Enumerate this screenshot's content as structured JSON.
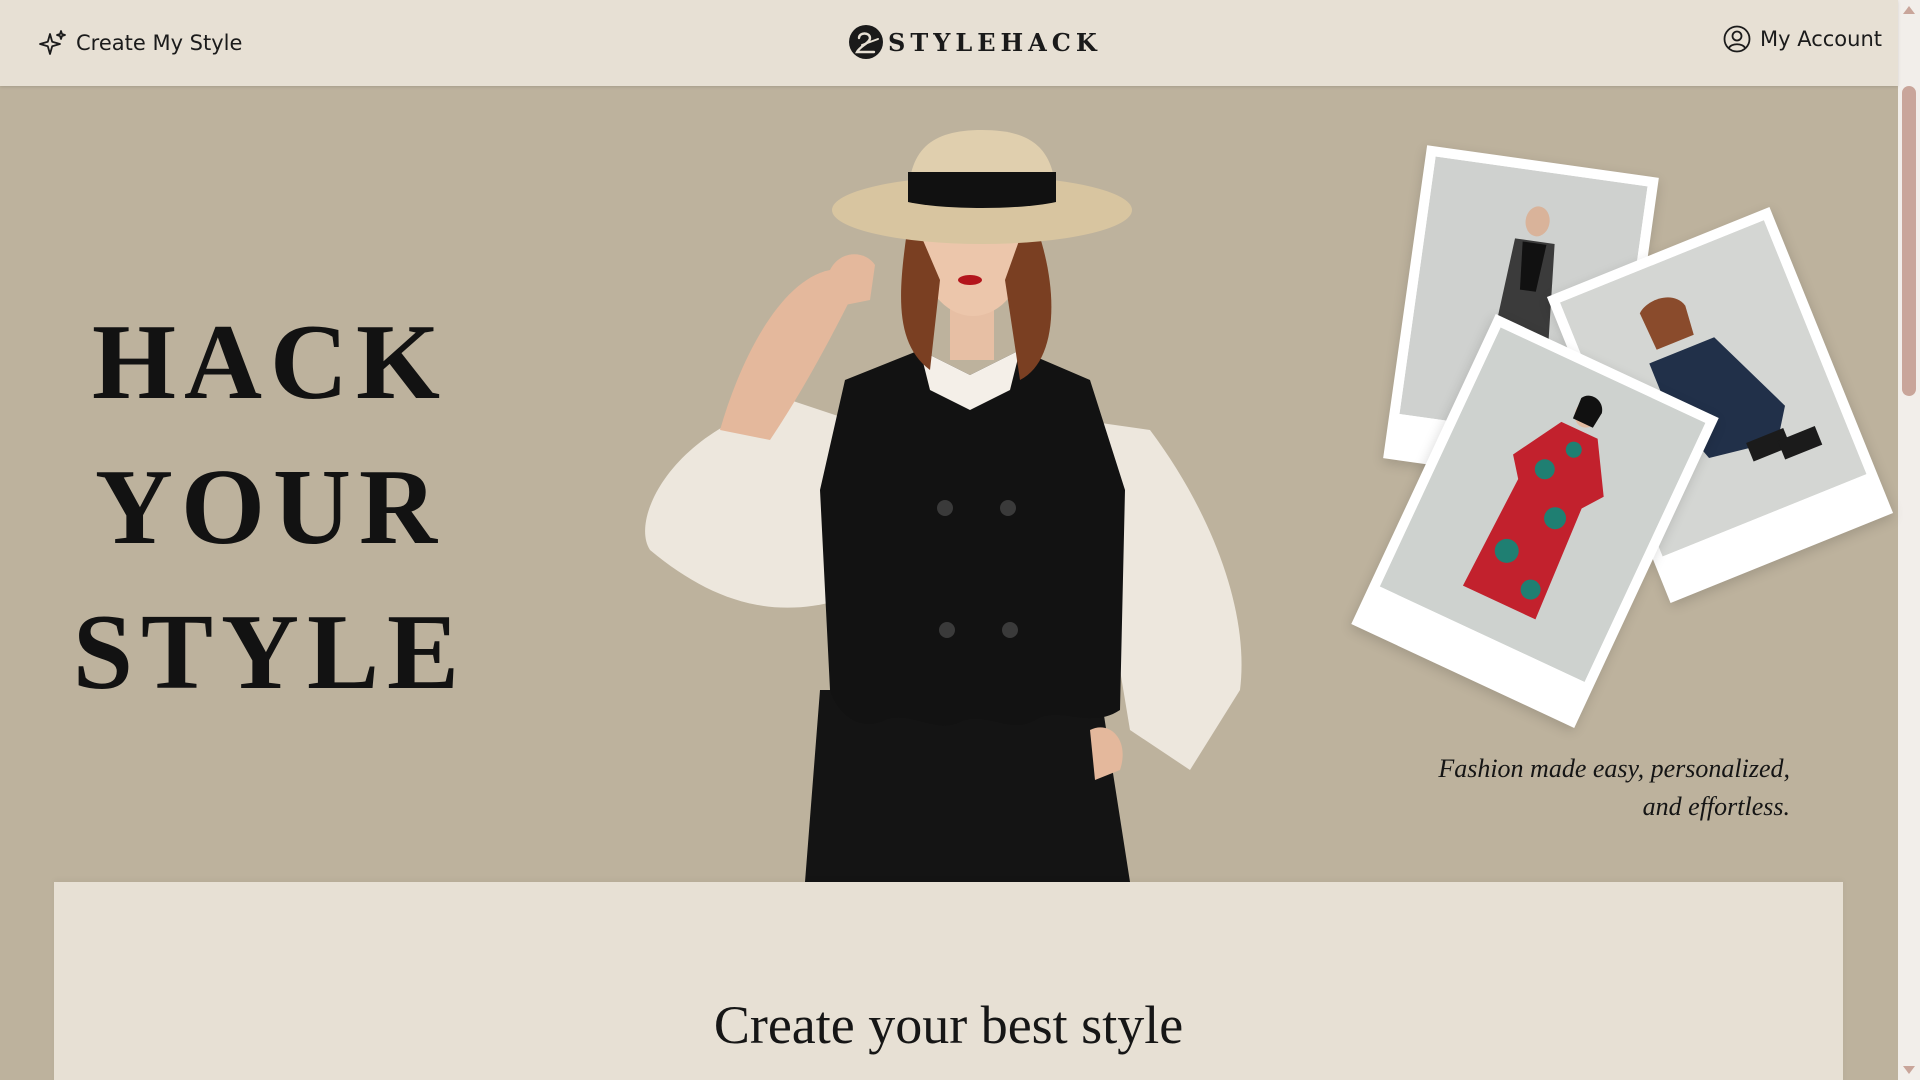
{
  "header": {
    "create_label": "Create My Style",
    "brand": "STYLEHACK",
    "account_label": "My Account"
  },
  "hero": {
    "title_lines": [
      "HACK",
      "YOUR",
      "STYLE"
    ],
    "tagline_line1": "Fashion made easy, personalized,",
    "tagline_line2": "and effortless."
  },
  "section": {
    "title": "Create your best style"
  },
  "icons": {
    "create": "sparkles-icon",
    "account": "user-circle-icon",
    "logo": "stylehack-logo-mark"
  },
  "colors": {
    "header_bg": "#e7e0d4",
    "hero_bg": "#bdb29d",
    "text": "#121212",
    "scroll_accent": "#c9a59a"
  }
}
